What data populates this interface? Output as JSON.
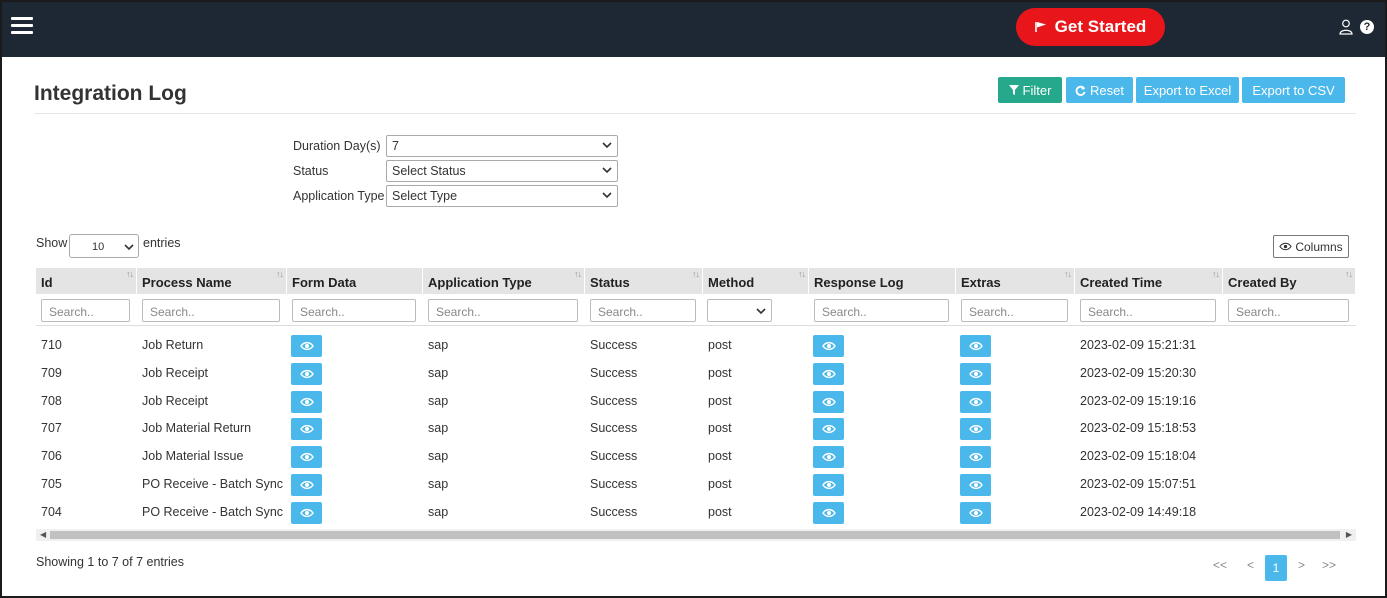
{
  "header": {
    "cta_label": "Get Started"
  },
  "page": {
    "title": "Integration Log"
  },
  "toolbar": {
    "filter": "Filter",
    "reset": "Reset",
    "excel": "Export to Excel",
    "csv": "Export to CSV"
  },
  "filters": {
    "duration_label": "Duration Day(s)",
    "duration_value": "7",
    "status_label": "Status",
    "status_value": "Select Status",
    "type_label": "Application Type",
    "type_value": "Select Type"
  },
  "entries": {
    "show": "Show",
    "value": "10",
    "suffix": "entries",
    "columns_button": "Columns"
  },
  "table": {
    "columns": [
      "Id",
      "Process Name",
      "Form Data",
      "Application Type",
      "Status",
      "Method",
      "Response Log",
      "Extras",
      "Created Time",
      "Created By"
    ],
    "search_placeholder": "Search..",
    "rows": [
      {
        "id": "710",
        "process": "Job Return",
        "app_type": "sap",
        "status": "Success",
        "method": "post",
        "created": "2023-02-09 15:21:31"
      },
      {
        "id": "709",
        "process": "Job Receipt",
        "app_type": "sap",
        "status": "Success",
        "method": "post",
        "created": "2023-02-09 15:20:30"
      },
      {
        "id": "708",
        "process": "Job Receipt",
        "app_type": "sap",
        "status": "Success",
        "method": "post",
        "created": "2023-02-09 15:19:16"
      },
      {
        "id": "707",
        "process": "Job Material Return",
        "app_type": "sap",
        "status": "Success",
        "method": "post",
        "created": "2023-02-09 15:18:53"
      },
      {
        "id": "706",
        "process": "Job Material Issue",
        "app_type": "sap",
        "status": "Success",
        "method": "post",
        "created": "2023-02-09 15:18:04"
      },
      {
        "id": "705",
        "process": "PO Receive - Batch Sync",
        "app_type": "sap",
        "status": "Success",
        "method": "post",
        "created": "2023-02-09 15:07:51"
      },
      {
        "id": "704",
        "process": "PO Receive - Batch Sync",
        "app_type": "sap",
        "status": "Success",
        "method": "post",
        "created": "2023-02-09 14:49:18"
      }
    ]
  },
  "footer": {
    "info": "Showing 1 to 7 of 7 entries",
    "first": "<<",
    "prev": "<",
    "page": "1",
    "next": ">",
    "last": ">>"
  },
  "colors": {
    "topbar": "#1e2834",
    "cta": "#e8161b",
    "primary": "#4bb8ec",
    "filter": "#26a88c"
  },
  "icons": {
    "menu": "hamburger-icon",
    "view": "eye-icon",
    "user": "user-icon",
    "help": "help-icon"
  }
}
